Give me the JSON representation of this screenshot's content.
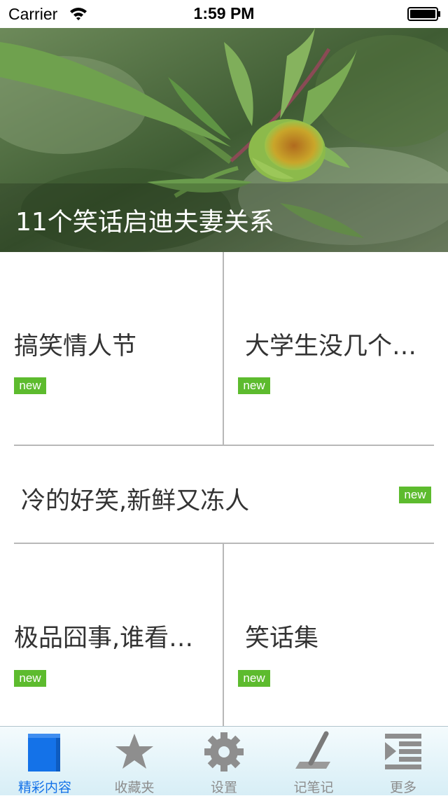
{
  "status_bar": {
    "carrier": "Carrier",
    "time": "1:59 PM"
  },
  "hero": {
    "caption": "11个笑话启迪夫妻关系"
  },
  "items": [
    {
      "title": "搞笑情人节",
      "badge": "new"
    },
    {
      "title": "大学生没几个…",
      "badge": "new"
    },
    {
      "title": "冷的好笑,新鲜又冻人",
      "badge": "new"
    },
    {
      "title": "极品囧事,谁看…",
      "badge": "new"
    },
    {
      "title": "笑话集",
      "badge": "new"
    }
  ],
  "tabs": [
    {
      "label": "精彩内容",
      "icon": "book-icon",
      "active": true
    },
    {
      "label": "收藏夹",
      "icon": "star-icon",
      "active": false
    },
    {
      "label": "设置",
      "icon": "gear-icon",
      "active": false
    },
    {
      "label": "记笔记",
      "icon": "pen-icon",
      "active": false
    },
    {
      "label": "更多",
      "icon": "list-icon",
      "active": false
    }
  ],
  "colors": {
    "badge": "#5dbb2e",
    "active_tab": "#1472e8",
    "inactive_tab": "#8c8c8c"
  }
}
